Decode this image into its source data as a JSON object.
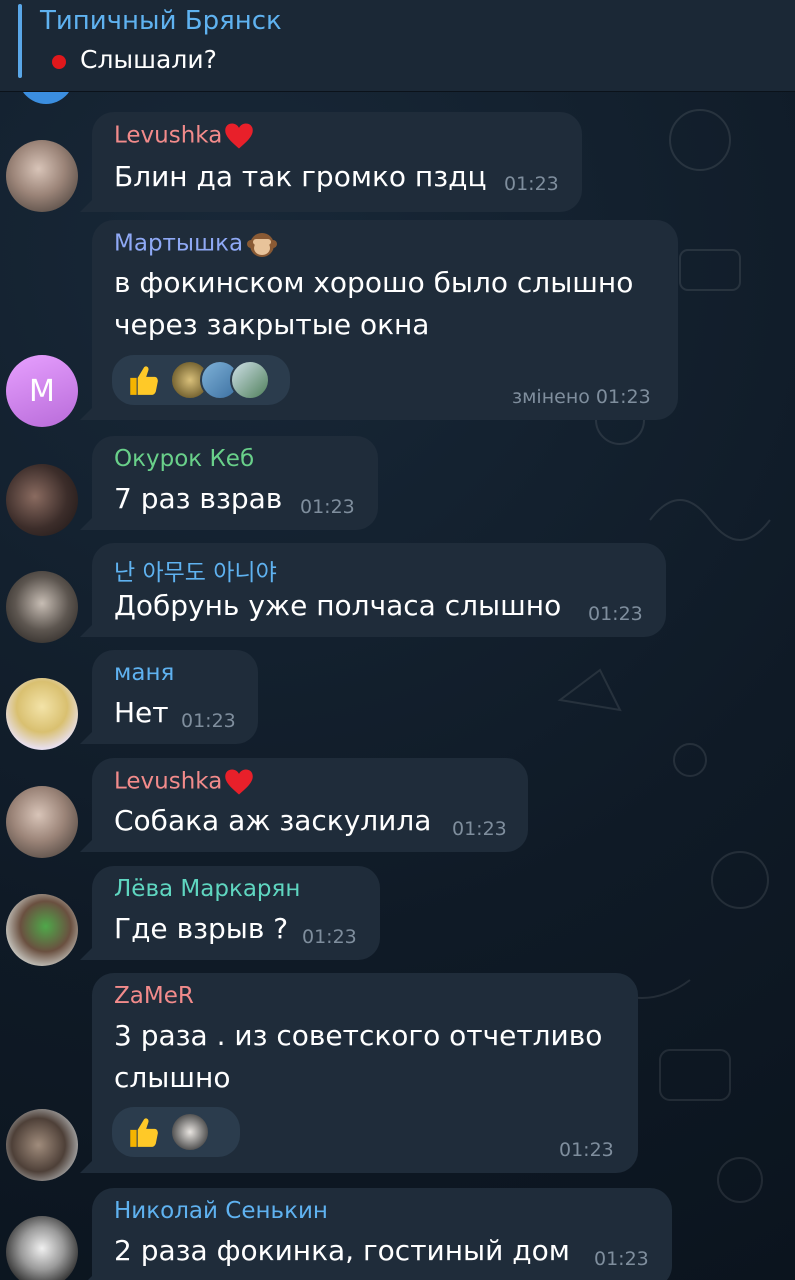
{
  "pinned": {
    "title": "Типичный Брянск",
    "text": "Слышали?"
  },
  "messages": [
    {
      "sender": "Levushka",
      "sender_color": "#f28b8b",
      "emoji": "heart",
      "lines": [
        "Блин да так громко пздц"
      ],
      "time": "01:23"
    },
    {
      "sender": "Мартышка",
      "sender_color": "#8fa9f5",
      "emoji": "monkey",
      "lines": [
        "в фокинском хорошо было слышно",
        "через закрытые окна"
      ],
      "time": "змінено 01:23",
      "avatar_letter": "М",
      "reactions": [
        "thumbs-up"
      ]
    },
    {
      "sender": "Окурок Кеб",
      "sender_color": "#69d08a",
      "lines": [
        "7 раз взрав"
      ],
      "time": "01:23"
    },
    {
      "sender": "난 아무도 아니야",
      "sender_color": "#5fb2f0",
      "lines": [
        "Добрунь уже полчаса слышно"
      ],
      "time": "01:23"
    },
    {
      "sender": "маня",
      "sender_color": "#5fb2f0",
      "lines": [
        "Нет"
      ],
      "time": "01:23"
    },
    {
      "sender": "Levushka",
      "sender_color": "#f28b8b",
      "emoji": "heart",
      "lines": [
        "Собака аж заскулила"
      ],
      "time": "01:23"
    },
    {
      "sender": "Лёва Маркарян",
      "sender_color": "#5fd6c0",
      "lines": [
        "Где взрыв ?"
      ],
      "time": "01:23"
    },
    {
      "sender": "ZaMeR",
      "sender_color": "#f28b8b",
      "lines": [
        "3 раза . из советского отчетливо",
        "слышно"
      ],
      "time": "01:23",
      "reactions": [
        "thumbs-up"
      ]
    },
    {
      "sender": "Николай Сенькин",
      "sender_color": "#5fb2f0",
      "lines": [
        "2 раза фокинка, гостиный дом"
      ],
      "time": "01:23"
    }
  ]
}
